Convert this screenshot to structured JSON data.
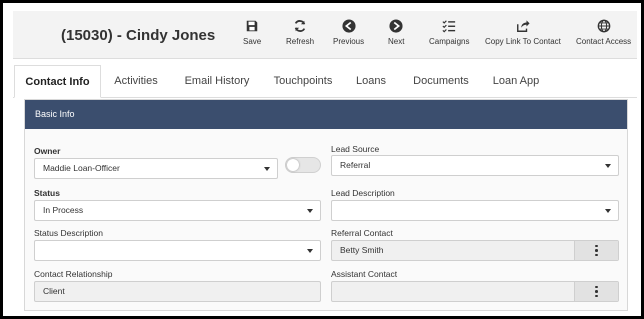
{
  "header": {
    "title": "(15030) - Cindy Jones",
    "toolbar": {
      "save": "Save",
      "refresh": "Refresh",
      "previous": "Previous",
      "next": "Next",
      "campaigns": "Campaigns",
      "copy_link": "Copy Link To Contact",
      "contact_access": "Contact Access"
    }
  },
  "tabs": [
    "Contact Info",
    "Activities",
    "Email History",
    "Touchpoints",
    "Loans",
    "Documents",
    "Loan App"
  ],
  "active_tab": "Contact Info",
  "panel": {
    "title": "Basic Info",
    "owner": {
      "label": "Owner",
      "value": "Maddie Loan-Officer"
    },
    "owner_toggle_on": false,
    "lead_source": {
      "label": "Lead Source",
      "value": "Referral"
    },
    "status": {
      "label": "Status",
      "value": "In Process"
    },
    "lead_description": {
      "label": "Lead Description",
      "value": ""
    },
    "status_description": {
      "label": "Status Description",
      "value": ""
    },
    "referral_contact": {
      "label": "Referral Contact",
      "value": "Betty Smith"
    },
    "contact_relationship": {
      "label": "Contact Relationship",
      "value": "Client"
    },
    "assistant_contact": {
      "label": "Assistant Contact",
      "value": ""
    }
  },
  "colors": {
    "panel_header": "#3b4e6e",
    "header_bg": "#f3f3f3"
  },
  "icons": [
    "save-icon",
    "refresh-icon",
    "previous-icon",
    "next-icon",
    "campaigns-icon",
    "share-icon",
    "globe-icon",
    "kebab-icon",
    "caret-down-icon"
  ]
}
